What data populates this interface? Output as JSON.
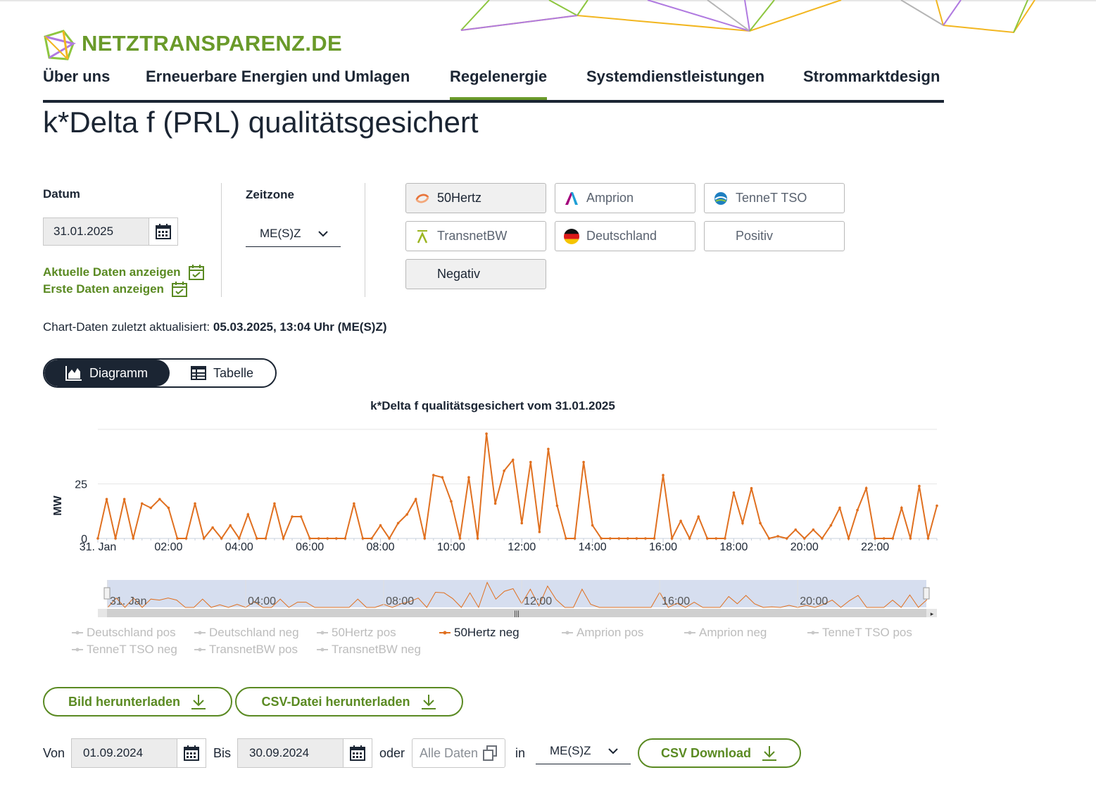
{
  "site": {
    "logo_text": "NETZTRANSPARENZ.DE"
  },
  "nav": [
    {
      "label": "Über uns",
      "active": false
    },
    {
      "label": "Erneuerbare Energien und Umlagen",
      "active": false
    },
    {
      "label": "Regelenergie",
      "active": true
    },
    {
      "label": "Systemdienstleistungen",
      "active": false
    },
    {
      "label": "Strommarktdesign",
      "active": false
    }
  ],
  "page_title": "k*Delta f (PRL) qualitätsgesichert",
  "filters": {
    "date_label": "Datum",
    "date_value": "31.01.2025",
    "current_data_link": "Aktuelle Daten anzeigen",
    "first_data_link": "Erste Daten anzeigen",
    "timezone_label": "Zeitzone",
    "timezone_value": "ME(S)Z",
    "chips": [
      {
        "label": "50Hertz",
        "icon": "50hertz-logo-icon",
        "selected": true
      },
      {
        "label": "Amprion",
        "icon": "amprion-logo-icon",
        "selected": false
      },
      {
        "label": "TenneT TSO",
        "icon": "tennet-logo-icon",
        "selected": false
      },
      {
        "label": "TransnetBW",
        "icon": "transnetbw-logo-icon",
        "selected": false
      },
      {
        "label": "Deutschland",
        "icon": "germany-flag-icon",
        "selected": false
      },
      {
        "label": "Positiv",
        "icon": "",
        "selected": false
      },
      {
        "label": "Negativ",
        "icon": "",
        "selected": true
      }
    ]
  },
  "updated": {
    "prefix": "Chart-Daten zuletzt aktualisiert: ",
    "value": "05.03.2025, 13:04 Uhr (ME(S)Z)"
  },
  "view_toggle": {
    "diagram": "Diagramm",
    "table": "Tabelle",
    "active": "diagram"
  },
  "chart_data": {
    "type": "line",
    "title": "k*Delta f qualitätsgesichert vom 31.01.2025",
    "ylabel": "MW",
    "xlabel": "",
    "y_ticks": [
      "0",
      "25"
    ],
    "ylim": [
      0,
      50
    ],
    "x_tick_labels": [
      "31. Jan",
      "02:00",
      "04:00",
      "06:00",
      "08:00",
      "10:00",
      "12:00",
      "14:00",
      "16:00",
      "18:00",
      "20:00",
      "22:00"
    ],
    "navigator_labels": [
      "31. Jan",
      "04:00",
      "08:00",
      "12:00",
      "16:00",
      "20:00"
    ],
    "grid": true,
    "color": "#e07020",
    "series": [
      {
        "name": "50Hertz neg",
        "x_interval": "15 min",
        "values": [
          0,
          18,
          0,
          18,
          0,
          16,
          14,
          18,
          14,
          0,
          0,
          16,
          0,
          5,
          0,
          6,
          0,
          11,
          0,
          0,
          16,
          0,
          10,
          10,
          0,
          0,
          0,
          0,
          0,
          16,
          0,
          0,
          6,
          0,
          7,
          11,
          18,
          0,
          29,
          28,
          17,
          0,
          28,
          0,
          48,
          16,
          31,
          36,
          7,
          35,
          3,
          41,
          15,
          0,
          0,
          35,
          6,
          0,
          0,
          0,
          0,
          0,
          0,
          0,
          29,
          0,
          8,
          0,
          10,
          0,
          0,
          0,
          21,
          7,
          23,
          7,
          0,
          1,
          0,
          4,
          0,
          4,
          0,
          6,
          14,
          0,
          13,
          23,
          0,
          0,
          0,
          14,
          0,
          24,
          0,
          15
        ]
      }
    ]
  },
  "legend": [
    {
      "label": "Deutschland pos",
      "active": false
    },
    {
      "label": "Deutschland neg",
      "active": false
    },
    {
      "label": "50Hertz pos",
      "active": false
    },
    {
      "label": "50Hertz neg",
      "active": true
    },
    {
      "label": "Amprion pos",
      "active": false
    },
    {
      "label": "Amprion neg",
      "active": false
    },
    {
      "label": "TenneT TSO pos",
      "active": false
    },
    {
      "label": "TenneT TSO neg",
      "active": false
    },
    {
      "label": "TransnetBW pos",
      "active": false
    },
    {
      "label": "TransnetBW neg",
      "active": false
    }
  ],
  "downloads": {
    "image": "Bild herunterladen",
    "csv": "CSV-Datei herunterladen"
  },
  "range": {
    "from_label": "Von",
    "from_value": "01.09.2024",
    "to_label": "Bis",
    "to_value": "30.09.2024",
    "or_label": "oder",
    "all_data": "Alle Daten",
    "in_label": "in",
    "timezone": "ME(S)Z",
    "csv_download": "CSV Download"
  }
}
